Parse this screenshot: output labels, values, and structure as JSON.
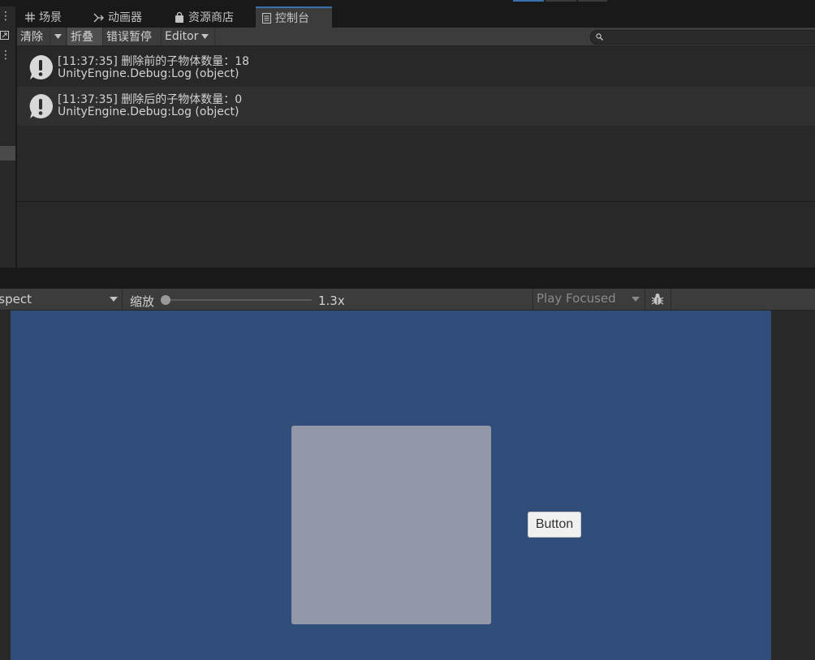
{
  "tabs": [
    {
      "label": "场景",
      "icon": "grid-icon"
    },
    {
      "label": "动画器",
      "icon": "animator-icon"
    },
    {
      "label": "资源商店",
      "icon": "shopping-bag-icon"
    },
    {
      "label": "控制台",
      "icon": "console-icon",
      "active": true
    }
  ],
  "console_toolbar": {
    "clear": "清除",
    "collapse": "折叠",
    "error_pause": "错误暂停",
    "editor": "Editor",
    "search_placeholder": ""
  },
  "logs": [
    {
      "line1": "[11:37:35] 删除前的子物体数量：18",
      "line2": "UnityEngine.Debug:Log (object)",
      "icon": "info-icon"
    },
    {
      "line1": "[11:37:35] 删除后的子物体数量：0",
      "line2": "UnityEngine.Debug:Log (object)",
      "icon": "info-icon"
    }
  ],
  "game_toolbar": {
    "aspect": "Aspect",
    "scale_label": "缩放",
    "scale_value": "1.3x",
    "play_mode": "Play Focused"
  },
  "game_view": {
    "button_label": "Button"
  },
  "colors": {
    "accent": "#3a72b0",
    "canvas": "#314d79",
    "square": "#9398a8"
  }
}
